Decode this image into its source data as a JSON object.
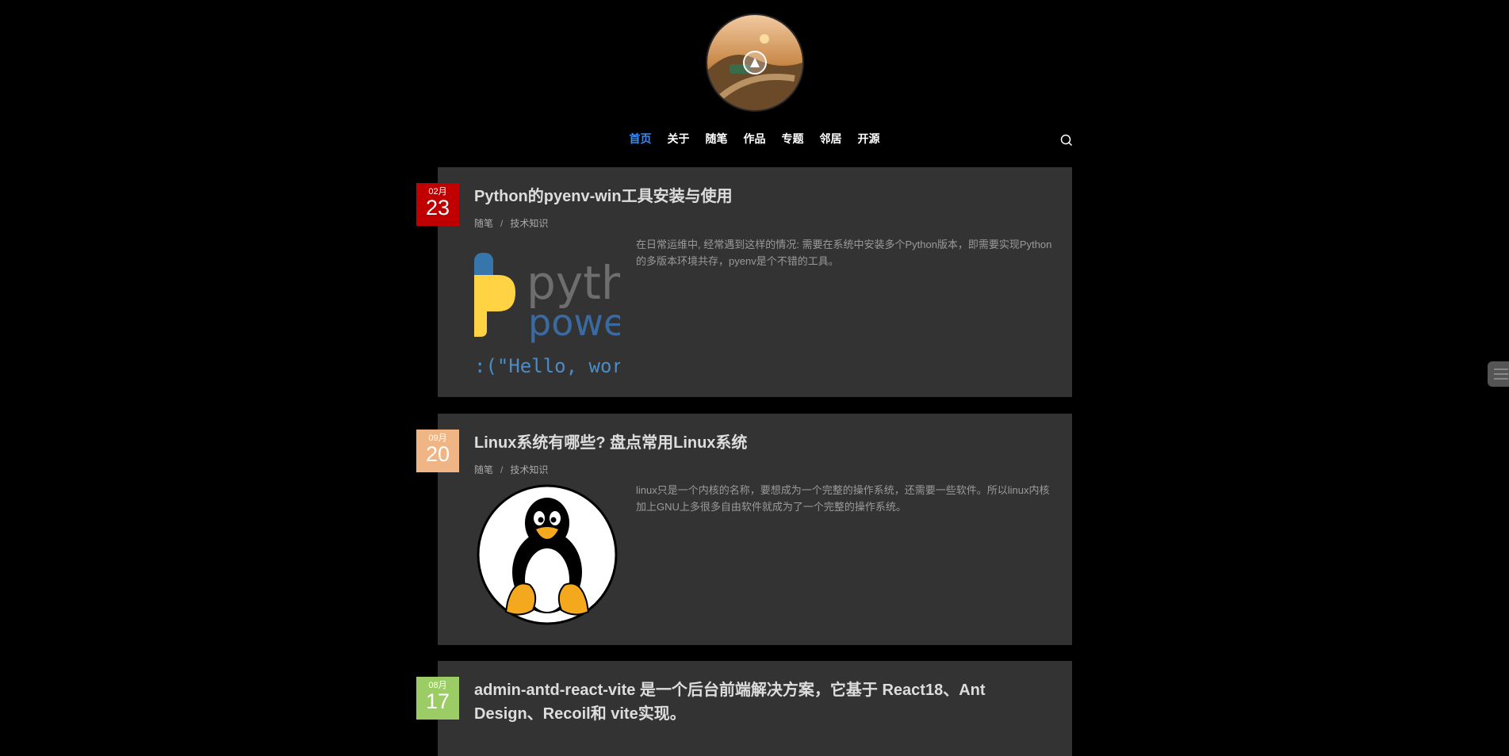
{
  "nav": {
    "items": [
      {
        "label": "首页",
        "active": true
      },
      {
        "label": "关于"
      },
      {
        "label": "随笔"
      },
      {
        "label": "作品"
      },
      {
        "label": "专题"
      },
      {
        "label": "邻居"
      },
      {
        "label": "开源"
      }
    ],
    "search_icon": "search-icon"
  },
  "posts": [
    {
      "month": "02月",
      "day": "23",
      "date_color": "#c00000",
      "title": "Python的pyenv-win工具安装与使用",
      "category": "随笔",
      "tag": "技术知识",
      "excerpt": "在日常运维中, 经常遇到这样的情况: 需要在系统中安装多个Python版本，即需要实现Python的多版本环境共存，pyenv是个不错的工具。",
      "thumb": {
        "word1": "pyth",
        "word2": "powe",
        "code": ":(\"Hello, wor"
      }
    },
    {
      "month": "09月",
      "day": "20",
      "date_color": "#f0b584",
      "title": "Linux系统有哪些? 盘点常用Linux系统",
      "category": "随笔",
      "tag": "技术知识",
      "excerpt": "linux只是一个内核的名称，要想成为一个完整的操作系统，还需要一些软件。所以linux内核加上GNU上多很多自由软件就成为了一个完整的操作系统。"
    },
    {
      "month": "08月",
      "day": "17",
      "date_color": "#9ccc65",
      "title": "admin-antd-react-vite 是一个后台前端解决方案，它基于 React18、Ant Design、Recoil和 vite实现。"
    }
  ],
  "separator": "/"
}
